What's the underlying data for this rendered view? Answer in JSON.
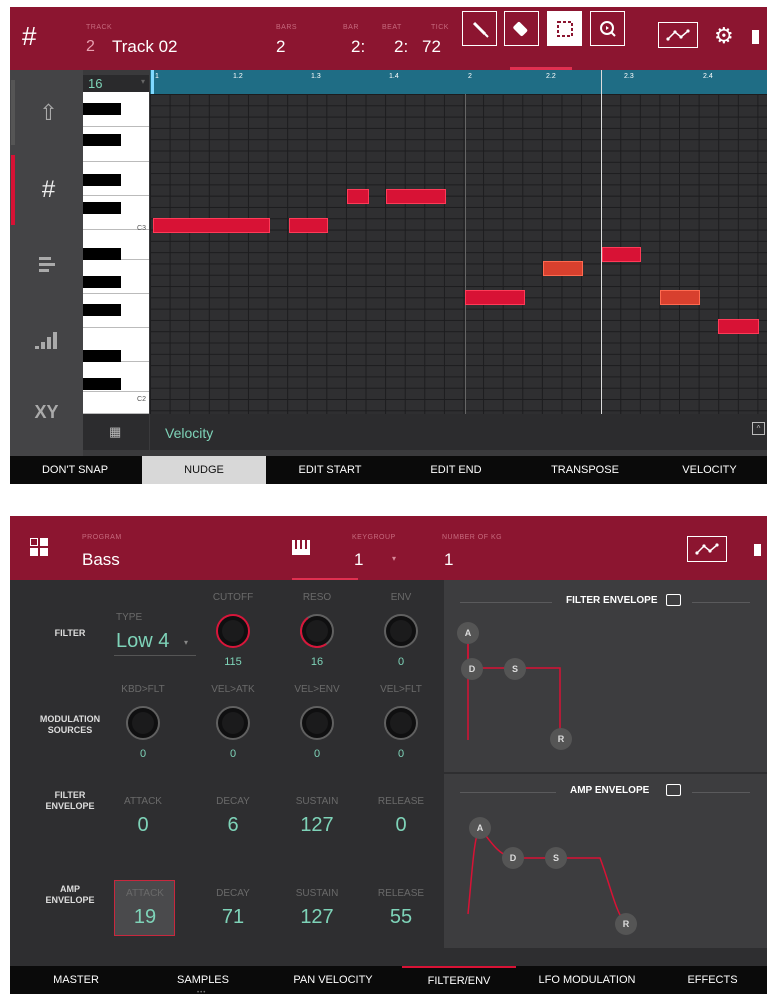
{
  "top": {
    "header": {
      "track_label": "TRACK",
      "track_num": "2",
      "track_name": "Track 02",
      "bars_label": "BARS",
      "bars_value": "2",
      "bar_label": "BAR",
      "bar_value": "2:",
      "beat_label": "BEAT",
      "beat_value": "2:",
      "tick_label": "TICK",
      "tick_value": "72"
    },
    "grid_division": "16",
    "ruler": [
      "1",
      "1.2",
      "1.3",
      "1.4",
      "2",
      "2.2",
      "2.3",
      "2.4"
    ],
    "keys": {
      "c3": "C3",
      "c2": "C2"
    },
    "lane_label": "Velocity",
    "bottom_buttons": [
      "DON'T SNAP",
      "NUDGE",
      "EDIT START",
      "EDIT END",
      "TRANSPOSE",
      "VELOCITY"
    ],
    "active_button": "NUDGE"
  },
  "bottom": {
    "header": {
      "program_label": "PROGRAM",
      "program_name": "Bass",
      "keygroup_label": "KEYGROUP",
      "keygroup_value": "1",
      "num_kg_label": "NUMBER OF KG",
      "num_kg_value": "1"
    },
    "filter": {
      "row_label": "FILTER",
      "type_label": "TYPE",
      "type_value": "Low 4",
      "cutoff_label": "CUTOFF",
      "cutoff_value": "115",
      "reso_label": "RESO",
      "reso_value": "16",
      "env_label": "ENV",
      "env_value": "0"
    },
    "modulation": {
      "row_label_1": "MODULATION",
      "row_label_2": "SOURCES",
      "labels": [
        "KBD>FLT",
        "VEL>ATK",
        "VEL>ENV",
        "VEL>FLT"
      ],
      "values": [
        "0",
        "0",
        "0",
        "0"
      ]
    },
    "filter_env": {
      "row_label_1": "FILTER",
      "row_label_2": "ENVELOPE",
      "labels": [
        "ATTACK",
        "DECAY",
        "SUSTAIN",
        "RELEASE"
      ],
      "values": [
        "0",
        "6",
        "127",
        "0"
      ]
    },
    "amp_env": {
      "row_label_1": "AMP",
      "row_label_2": "ENVELOPE",
      "labels": [
        "ATTACK",
        "DECAY",
        "SUSTAIN",
        "RELEASE"
      ],
      "values": [
        "19",
        "71",
        "127",
        "55"
      ]
    },
    "filter_env_title": "FILTER ENVELOPE",
    "amp_env_title": "AMP ENVELOPE",
    "env_points": [
      "A",
      "D",
      "S",
      "R"
    ],
    "tabs": [
      "MASTER",
      "SAMPLES",
      "PAN VELOCITY",
      "FILTER/ENV",
      "LFO MODULATION",
      "EFFECTS"
    ],
    "active_tab": "FILTER/ENV"
  },
  "colors": {
    "accent": "#8c1530",
    "note": "#d81235",
    "teal": "#7ed3b8",
    "ruler": "#1f6d85"
  }
}
